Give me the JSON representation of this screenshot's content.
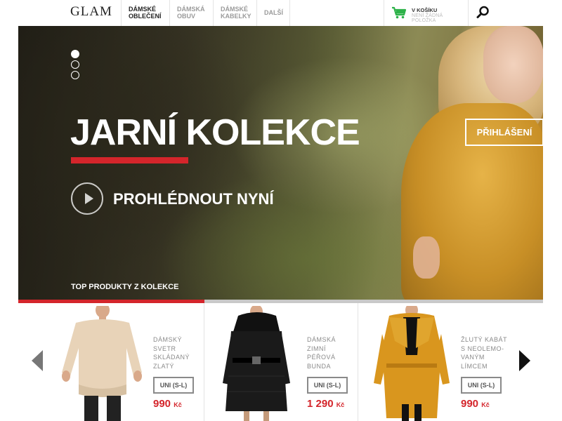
{
  "header": {
    "logo": "GLAM",
    "nav": [
      {
        "label": "DÁMSKÉ\nOBLEČENÍ",
        "active": true
      },
      {
        "label": "DÁMSKÁ\nOBUV",
        "active": false
      },
      {
        "label": "DÁMSKÉ\nKABELKY",
        "active": false
      },
      {
        "label": "DALŠÍ",
        "active": false
      }
    ],
    "cart": {
      "title": "V KOŠÍKU",
      "subtitle": "NENÍ ŽÁDNÁ POLOŽKA",
      "icon": "cart-icon",
      "color": "#2eb24a"
    },
    "search_icon": "search-icon"
  },
  "hero": {
    "title": "JARNÍ KOLEKCE",
    "cta": "PROHLÉDNOUT NYNÍ",
    "login": "PŘIHLÁŠENÍ",
    "section_label": "TOP PRODUKTY Z KOLEKCE",
    "slides": 3,
    "active_slide": 1,
    "accent_color": "#d4252b"
  },
  "carousel_progress": 0.355,
  "products": [
    {
      "name": "DÁMSKÝ SVETR SKLÁDANÝ ZLATÝ",
      "size": "UNI (S-L)",
      "price": "990",
      "currency": "Kč",
      "color": "#e8d3b8"
    },
    {
      "name": "DÁMSKÁ ZIMNÍ PÉŘOVÁ BUNDA",
      "size": "UNI (S-L)",
      "price": "1 290",
      "currency": "Kč",
      "color": "#1a1a1a"
    },
    {
      "name": "ŽLUTÝ KABÁT S NEOLEMO-VANÝM LÍMCEM",
      "size": "UNI (S-L)",
      "price": "990",
      "currency": "Kč",
      "color": "#d9961e"
    }
  ],
  "arrows": {
    "prev": "arrow-left-icon",
    "next": "arrow-right-icon"
  }
}
